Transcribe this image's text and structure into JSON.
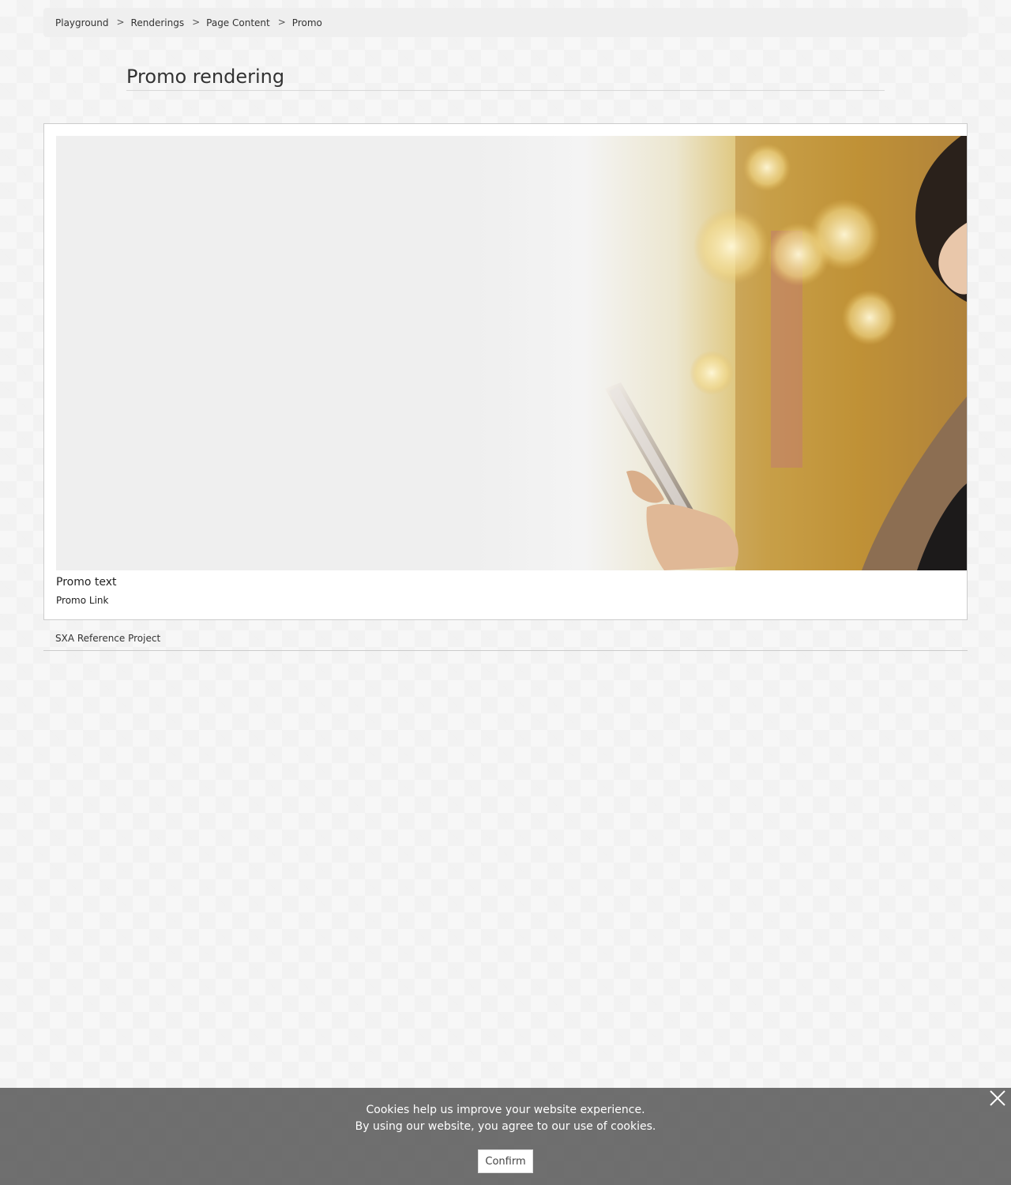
{
  "breadcrumb": {
    "items": [
      {
        "label": "Playground"
      },
      {
        "label": "Renderings"
      },
      {
        "label": "Page Content"
      },
      {
        "label": "Promo"
      }
    ],
    "separator": ">"
  },
  "page": {
    "title": "Promo rendering"
  },
  "promo": {
    "text": "Promo text",
    "link": "Promo Link"
  },
  "footer": {
    "text": "SXA Reference Project"
  },
  "cookie_bar": {
    "line1": "Cookies help us improve your website experience.",
    "line2": "By using our website, you agree to our use of cookies.",
    "confirm_label": "Confirm",
    "close_icon": "close-icon"
  },
  "colors": {
    "breadcrumb_bg": "#efefef",
    "cookie_bar_bg": "#646464",
    "image_warm": "#d9b95a"
  }
}
